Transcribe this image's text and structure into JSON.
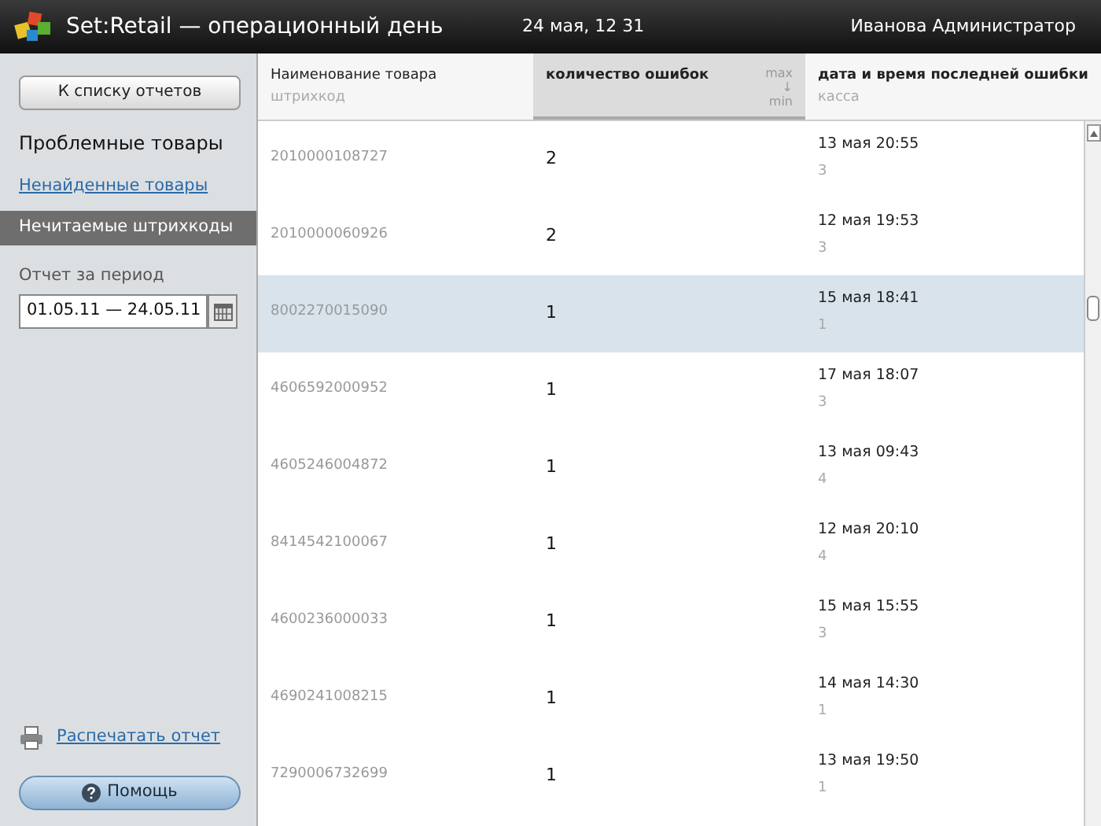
{
  "header": {
    "title": "Set:Retail — операционный день",
    "datetime": "24 мая, 12 31",
    "user": "Иванова Администратор"
  },
  "sidebar": {
    "back_button": "К списку отчетов",
    "section_title": "Проблемные товары",
    "items": [
      {
        "label": "Ненайденные товары",
        "selected": false
      },
      {
        "label": "Нечитаемые штрихкоды",
        "selected": true
      }
    ],
    "period_label": "Отчет за период",
    "period_value": "01.05.11 — 24.05.11",
    "print_link": "Распечатать отчет",
    "help_button": "Помощь"
  },
  "table": {
    "columns": [
      {
        "title": "Наименование товара",
        "subtitle": "штрихкод",
        "sorted": false
      },
      {
        "title": "количество ошибок",
        "sorted": true,
        "sort_top": "max",
        "sort_arrow": "↓",
        "sort_bottom": "min"
      },
      {
        "title": "дата и время последней ошибки",
        "subtitle": "касса",
        "sorted": false
      }
    ],
    "rows": [
      {
        "barcode": "2010000108727",
        "errors": "2",
        "datetime": "13 мая 20:55",
        "register": "3",
        "selected": false
      },
      {
        "barcode": "2010000060926",
        "errors": "2",
        "datetime": "12 мая 19:53",
        "register": "3",
        "selected": false
      },
      {
        "barcode": "8002270015090",
        "errors": "1",
        "datetime": "15 мая 18:41",
        "register": "1",
        "selected": true
      },
      {
        "barcode": "4606592000952",
        "errors": "1",
        "datetime": "17 мая 18:07",
        "register": "3",
        "selected": false
      },
      {
        "barcode": "4605246004872",
        "errors": "1",
        "datetime": "13 мая 09:43",
        "register": "4",
        "selected": false
      },
      {
        "barcode": "8414542100067",
        "errors": "1",
        "datetime": "12 мая 20:10",
        "register": "4",
        "selected": false
      },
      {
        "barcode": "4600236000033",
        "errors": "1",
        "datetime": "15 мая 15:55",
        "register": "3",
        "selected": false
      },
      {
        "barcode": "4690241008215",
        "errors": "1",
        "datetime": "14 мая 14:30",
        "register": "1",
        "selected": false
      },
      {
        "barcode": "7290006732699",
        "errors": "1",
        "datetime": "13 мая 19:50",
        "register": "1",
        "selected": false
      }
    ]
  }
}
